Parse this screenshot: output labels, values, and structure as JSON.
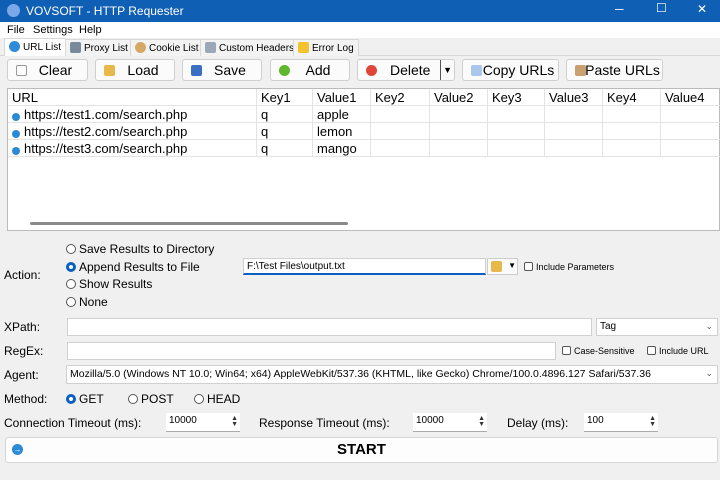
{
  "window": {
    "title": "VOVSOFT - HTTP Requester"
  },
  "menu": [
    "File",
    "Settings",
    "Help"
  ],
  "tabs": [
    "URL List",
    "Proxy List",
    "Cookie List",
    "Custom Headers",
    "Error Log"
  ],
  "toolbar": {
    "clear": "Clear",
    "load": "Load",
    "save": "Save",
    "add": "Add",
    "delete": "Delete",
    "copy_urls": "Copy URLs",
    "paste_urls": "Paste URLs"
  },
  "grid": {
    "columns": [
      "URL",
      "Key1",
      "Value1",
      "Key2",
      "Value2",
      "Key3",
      "Value3",
      "Key4",
      "Value4"
    ],
    "rows": [
      [
        "https://test1.com/search.php",
        "q",
        "apple"
      ],
      [
        "https://test2.com/search.php",
        "q",
        "lemon"
      ],
      [
        "https://test3.com/search.php",
        "q",
        "mango"
      ]
    ]
  },
  "action": {
    "label": "Action:",
    "options": [
      "Save Results to Directory",
      "Append Results to File",
      "Show Results",
      "None"
    ],
    "selected": 1,
    "file_path": "F:\\Test Files\\output.txt",
    "include_parameters": "Include Parameters"
  },
  "xpath": {
    "label": "XPath:",
    "value": "",
    "type": "Tag"
  },
  "regex": {
    "label": "RegEx:",
    "value": "",
    "case_sensitive": "Case-Sensitive",
    "include_url": "Include URL"
  },
  "agent": {
    "label": "Agent:",
    "value": "Mozilla/5.0 (Windows NT 10.0; Win64; x64) AppleWebKit/537.36 (KHTML, like Gecko) Chrome/100.0.4896.127 Safari/537.36"
  },
  "method": {
    "label": "Method:",
    "options": [
      "GET",
      "POST",
      "HEAD"
    ],
    "selected": 0
  },
  "timeouts": {
    "conn_label": "Connection Timeout (ms):",
    "conn": "10000",
    "resp_label": "Response Timeout (ms):",
    "resp": "10000",
    "delay_label": "Delay (ms):",
    "delay": "100"
  },
  "start": "START",
  "colors": {
    "titlebar": "#0f5fb5",
    "accent": "#0a5fc4"
  }
}
